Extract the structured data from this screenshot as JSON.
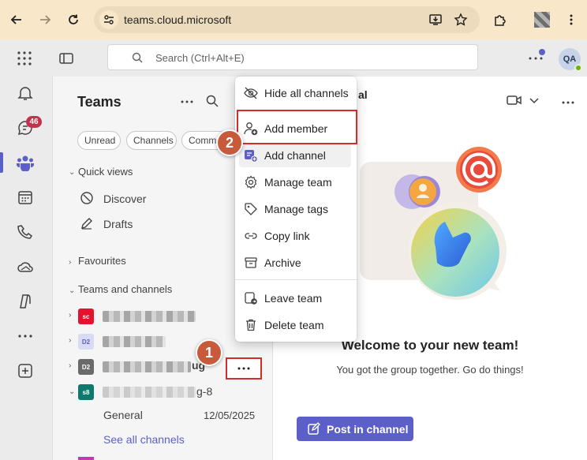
{
  "browser": {
    "url": "teams.cloud.microsoft"
  },
  "header": {
    "search_placeholder": "Search (Ctrl+Alt+E)",
    "avatar_initials": "QA"
  },
  "rail": {
    "chat_badge": "46",
    "accent_color": "#5b5fc7"
  },
  "panel": {
    "title": "Teams",
    "filters": [
      "Unread",
      "Channels",
      "Comm"
    ],
    "quick_views_label": "Quick views",
    "quick_views": [
      "Discover",
      "Drafts"
    ],
    "favourites_label": "Favourites",
    "teams_channels_label": "Teams and channels",
    "teams": [
      {
        "tile": "sc",
        "name_suffix": ""
      },
      {
        "tile": "D2",
        "name_suffix": ""
      },
      {
        "tile": "D2",
        "name_suffix": "ug"
      },
      {
        "tile": "s8",
        "name_suffix": "g-8"
      }
    ],
    "channel": {
      "name": "General",
      "date": "12/05/2025"
    },
    "see_all": "See all channels"
  },
  "menu": {
    "items": [
      {
        "label": "Hide all channels",
        "icon": "eye-off-icon"
      },
      {
        "label": "Add member",
        "icon": "person-add-icon"
      },
      {
        "label": "Add channel",
        "icon": "channel-add-icon"
      },
      {
        "label": "Manage team",
        "icon": "gear-icon"
      },
      {
        "label": "Manage tags",
        "icon": "tag-icon"
      },
      {
        "label": "Copy link",
        "icon": "link-icon"
      },
      {
        "label": "Archive",
        "icon": "archive-icon"
      },
      {
        "label": "Leave team",
        "icon": "leave-icon"
      },
      {
        "label": "Delete team",
        "icon": "trash-icon"
      }
    ]
  },
  "main": {
    "title_fragment": "al",
    "welcome_title": "Welcome to your new team!",
    "welcome_sub": "You got the group together. Go do things!",
    "post_button": "Post in channel"
  },
  "steps": [
    "1",
    "2"
  ]
}
